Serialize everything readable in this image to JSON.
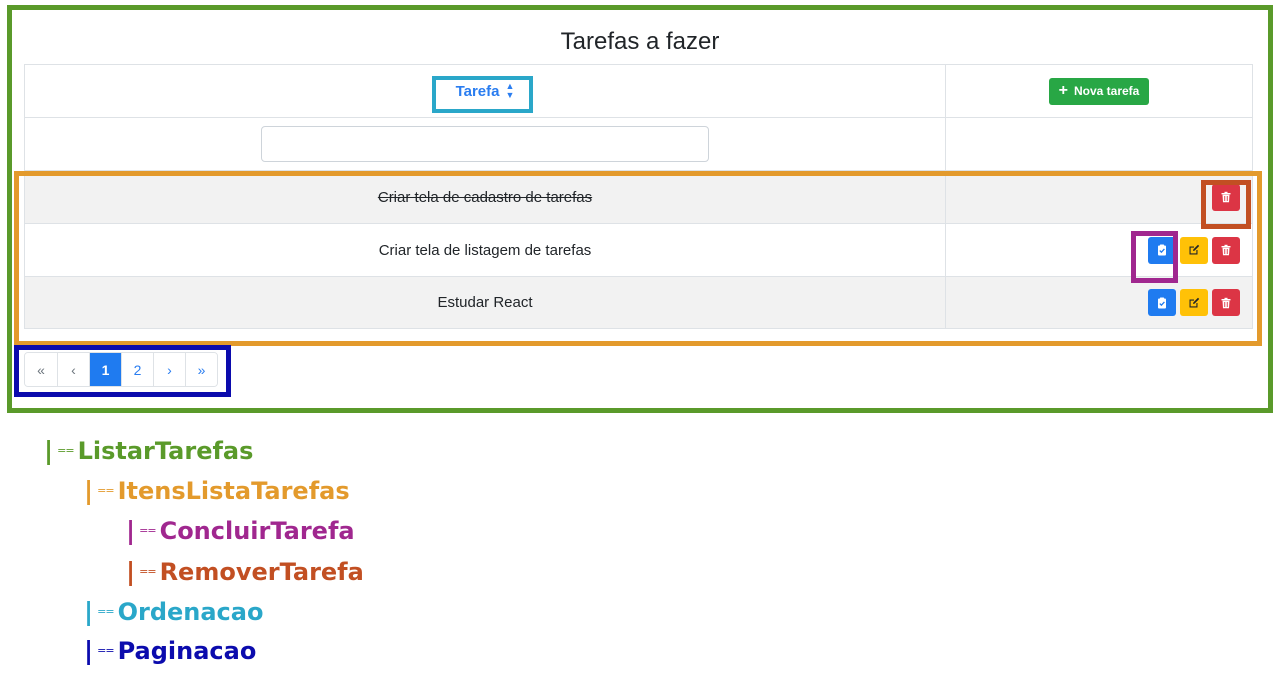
{
  "page_title": "Tarefas a fazer",
  "table": {
    "sort_header_label": "Tarefa",
    "sort_icon": "sort-updown-icon",
    "new_task_label": "Nova tarefa",
    "filter_value": "",
    "rows": [
      {
        "name": "Criar tela de cadastro de tarefas",
        "completed": true
      },
      {
        "name": "Criar tela de listagem de tarefas",
        "completed": false
      },
      {
        "name": "Estudar React",
        "completed": false
      }
    ]
  },
  "pagination": {
    "first": "«",
    "prev": "‹",
    "pages": [
      "1",
      "2"
    ],
    "active_page": "1",
    "next": "›",
    "last": "»"
  },
  "tree": [
    {
      "connector": "|",
      "dash": "==",
      "label": "ListarTarefas",
      "color": "#5a9a2a"
    },
    {
      "connector": "|",
      "dash": "==",
      "label": "ItensListaTarefas",
      "color": "#e39a2c"
    },
    {
      "connector": "|",
      "dash": "==",
      "label": "ConcluirTarefa",
      "color": "#a0278f"
    },
    {
      "connector": "|",
      "dash": "==",
      "label": "RemoverTarefa",
      "color": "#c24f22"
    },
    {
      "connector": "|",
      "dash": "==",
      "label": "Ordenacao",
      "color": "#2aa7c9"
    },
    {
      "connector": "|",
      "dash": "==",
      "label": "Paginacao",
      "color": "#0b0bad"
    }
  ],
  "colors": {
    "listar": "#5a9a2a",
    "itens": "#e39a2c",
    "concluir": "#a0278f",
    "remover": "#c24f22",
    "ordenacao": "#2aa7c9",
    "paginacao": "#0b0bad",
    "primary": "#1f7bf0",
    "success": "#28a745",
    "warning": "#ffc107",
    "danger": "#dc3545"
  }
}
